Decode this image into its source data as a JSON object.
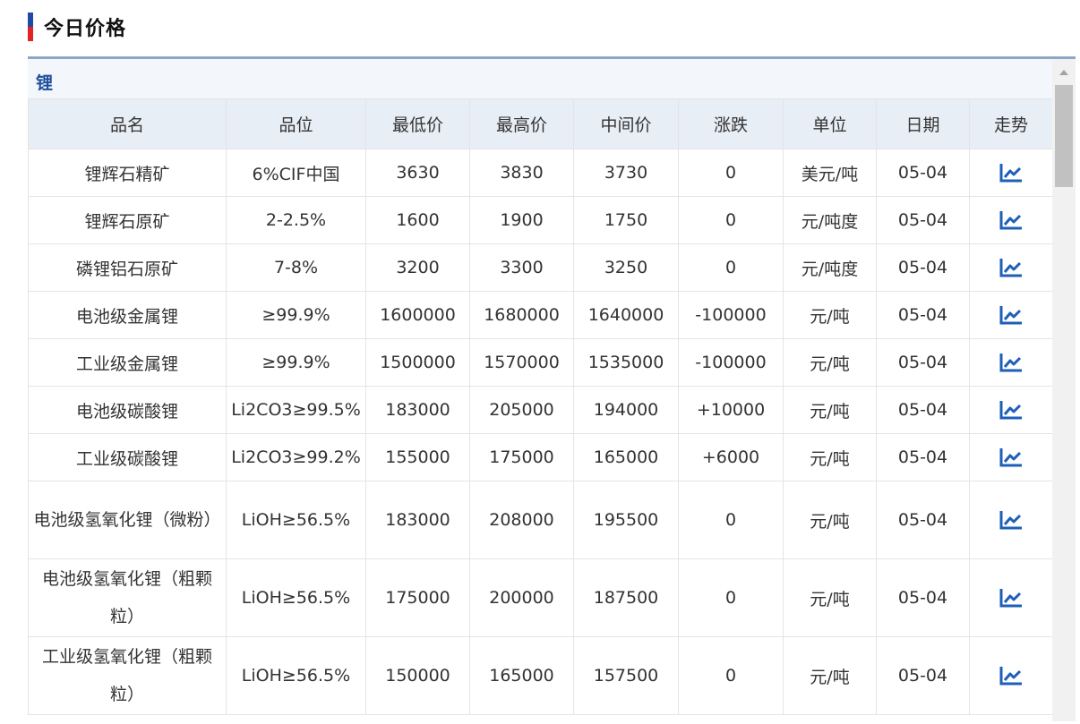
{
  "header": {
    "title": "今日价格"
  },
  "colors": {
    "accent_blue": "#1f4aa8",
    "accent_red": "#e02424",
    "price_up": "#e02424",
    "price_down": "#11a33a",
    "category_text": "#1d4f9c"
  },
  "category": {
    "label": "锂"
  },
  "table": {
    "headers": [
      "品名",
      "品位",
      "最低价",
      "最高价",
      "中间价",
      "涨跌",
      "单位",
      "日期",
      "走势"
    ],
    "rows": [
      {
        "name": "锂辉石精矿",
        "grade": "6%CIF中国",
        "low": "3630",
        "high": "3830",
        "mid": "3730",
        "change": "0",
        "unit": "美元/吨",
        "date": "05-04",
        "trend": "up"
      },
      {
        "name": "锂辉石原矿",
        "grade": "2-2.5%",
        "low": "1600",
        "high": "1900",
        "mid": "1750",
        "change": "0",
        "unit": "元/吨度",
        "date": "05-04",
        "trend": "flat"
      },
      {
        "name": "磷锂铝石原矿",
        "grade": "7-8%",
        "low": "3200",
        "high": "3300",
        "mid": "3250",
        "change": "0",
        "unit": "元/吨度",
        "date": "05-04",
        "trend": "flat"
      },
      {
        "name": "电池级金属锂",
        "grade": "≥99.9%",
        "low": "1600000",
        "high": "1680000",
        "mid": "1640000",
        "change": "-100000",
        "unit": "元/吨",
        "date": "05-04",
        "trend": "down"
      },
      {
        "name": "工业级金属锂",
        "grade": "≥99.9%",
        "low": "1500000",
        "high": "1570000",
        "mid": "1535000",
        "change": "-100000",
        "unit": "元/吨",
        "date": "05-04",
        "trend": "down"
      },
      {
        "name": "电池级碳酸锂",
        "grade": "Li2CO3≥99.5%",
        "low": "183000",
        "high": "205000",
        "mid": "194000",
        "change": "+10000",
        "unit": "元/吨",
        "date": "05-04",
        "trend": "up"
      },
      {
        "name": "工业级碳酸锂",
        "grade": "Li2CO3≥99.2%",
        "low": "155000",
        "high": "175000",
        "mid": "165000",
        "change": "+6000",
        "unit": "元/吨",
        "date": "05-04",
        "trend": "up"
      },
      {
        "name": "电池级氢氧化锂（微粉）",
        "grade": "LiOH≥56.5%",
        "low": "183000",
        "high": "208000",
        "mid": "195500",
        "change": "0",
        "unit": "元/吨",
        "date": "05-04",
        "trend": "flat"
      },
      {
        "name": "电池级氢氧化锂（粗颗粒）",
        "grade": "LiOH≥56.5%",
        "low": "175000",
        "high": "200000",
        "mid": "187500",
        "change": "0",
        "unit": "元/吨",
        "date": "05-04",
        "trend": "flat"
      },
      {
        "name": "工业级氢氧化锂（粗颗粒）",
        "grade": "LiOH≥56.5%",
        "low": "150000",
        "high": "165000",
        "mid": "157500",
        "change": "0",
        "unit": "元/吨",
        "date": "05-04",
        "trend": "flat"
      }
    ]
  },
  "icons": {
    "trend": "line-chart-icon",
    "scroll_up": "chevron-up-icon"
  }
}
